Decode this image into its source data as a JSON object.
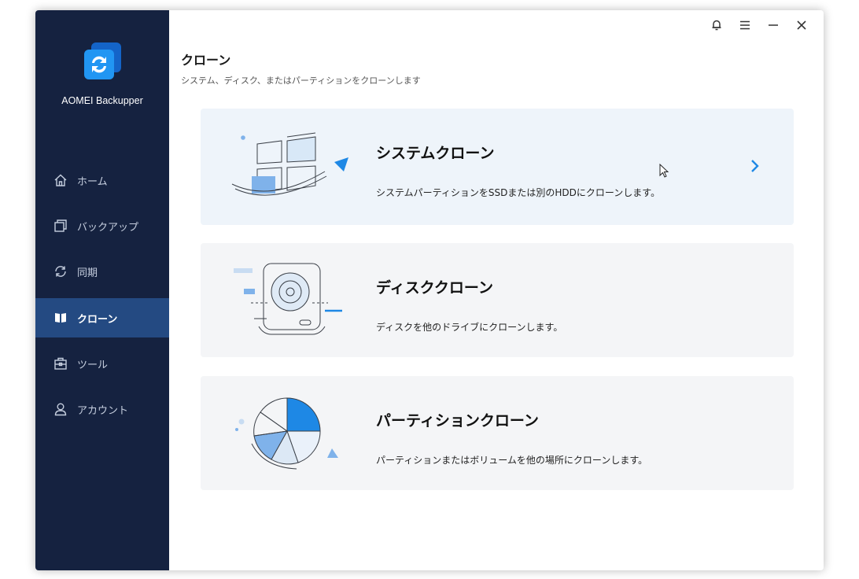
{
  "app": {
    "name": "AOMEI Backupper"
  },
  "window_controls": {
    "notify": "notification-bell",
    "menu": "menu",
    "minimize": "minimize",
    "close": "close"
  },
  "sidebar": {
    "items": [
      {
        "label": "ホーム",
        "icon": "home-icon"
      },
      {
        "label": "バックアップ",
        "icon": "backup-icon"
      },
      {
        "label": "同期",
        "icon": "sync-icon"
      },
      {
        "label": "クローン",
        "icon": "clone-icon",
        "active": true
      },
      {
        "label": "ツール",
        "icon": "tools-icon"
      },
      {
        "label": "アカウント",
        "icon": "account-icon"
      }
    ]
  },
  "main": {
    "title": "クローン",
    "subtitle": "システム、ディスク、またはパーティションをクローンします",
    "cards": [
      {
        "title": "システムクローン",
        "description": "システムパーティションをSSDまたは別のHDDにクローンします。"
      },
      {
        "title": "ディスククローン",
        "description": "ディスクを他のドライブにクローンします。"
      },
      {
        "title": "パーティションクローン",
        "description": "パーティションまたはボリュームを他の場所にクローンします。"
      }
    ]
  },
  "colors": {
    "sidebar_bg": "#152240",
    "sidebar_active": "#244a82",
    "accent": "#1e88e5",
    "card_bg": "#f4f5f7"
  }
}
